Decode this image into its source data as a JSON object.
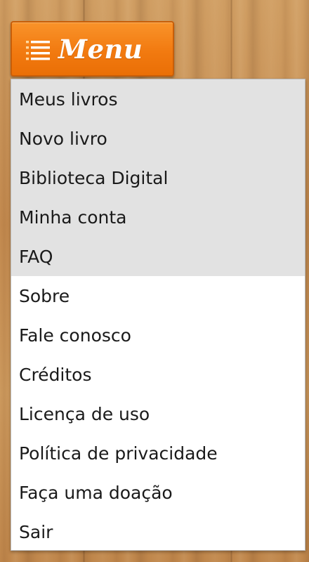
{
  "menu_button": {
    "icon": "hamburger-icon",
    "label": "Menu",
    "accent_color": "#f27a10"
  },
  "menu": {
    "shaded_items": [
      {
        "label": "Meus livros"
      },
      {
        "label": "Novo livro"
      },
      {
        "label": "Biblioteca Digital"
      },
      {
        "label": "Minha conta"
      },
      {
        "label": "FAQ"
      }
    ],
    "items": [
      {
        "label": "Sobre"
      },
      {
        "label": "Fale conosco"
      },
      {
        "label": "Créditos"
      },
      {
        "label": "Licença de uso"
      },
      {
        "label": "Política de privacidade"
      },
      {
        "label": "Faça uma doação"
      },
      {
        "label": "Sair"
      }
    ]
  }
}
